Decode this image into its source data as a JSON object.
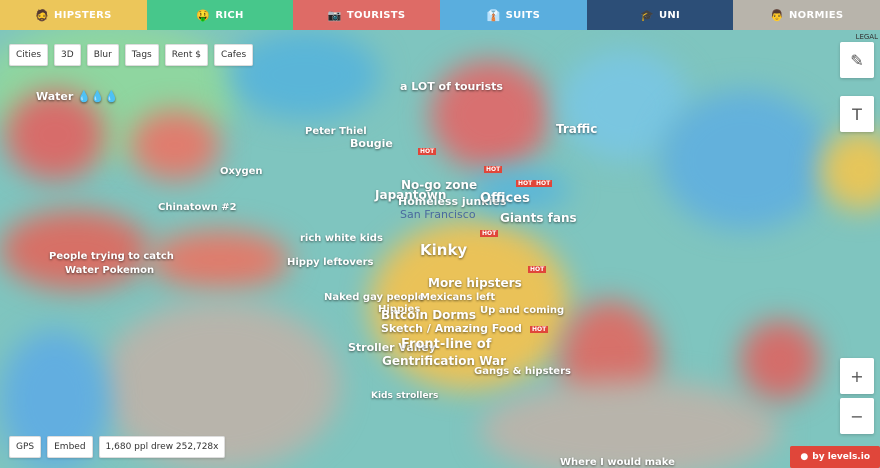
{
  "tabs": [
    {
      "label": "Hipsters",
      "color": "#ecc65a",
      "icon": "🧔"
    },
    {
      "label": "Rich",
      "color": "#47c78b",
      "icon": "🤑"
    },
    {
      "label": "Tourists",
      "color": "#de6b66",
      "icon": "📷"
    },
    {
      "label": "Suits",
      "color": "#5aaede",
      "icon": "👔"
    },
    {
      "label": "Uni",
      "color": "#2c4e77",
      "icon": "🎓"
    },
    {
      "label": "Normies",
      "color": "#b8b4ab",
      "icon": "👨"
    }
  ],
  "toolbar": [
    "Cities",
    "3D",
    "Blur",
    "Tags",
    "Rent $",
    "Cafes"
  ],
  "legal": "LEGAL",
  "side": {
    "draw_icon": "✎",
    "text_icon": "T",
    "zoom_in": "+",
    "zoom_out": "−"
  },
  "bottom": [
    "GPS",
    "Embed",
    "1,680 ppl drew 252,728x"
  ],
  "levels": "by levels.io",
  "map_city": "San Francisco",
  "hot_tag": "HOT",
  "labels": [
    "Water 💧💧💧",
    "a LOT of tourists",
    "Peter Thiel",
    "Bougie",
    "Traffic",
    "Oxygen",
    "No-go zone",
    "Japantown",
    "Homeless junkies",
    "Offices",
    "Chinatown #2",
    "Giants fans",
    "rich white kids",
    "Kinky",
    "People trying to catch",
    "Water Pokemon",
    "Hippy leftovers",
    "More hipsters",
    "Naked gay people",
    "Mexicans left",
    "Hippies",
    "Bitcoin Dorms",
    "Up and coming",
    "Sketch / Amazing Food",
    "Stroller Valley",
    "Front-line of",
    "Gentrification War",
    "Gangs & hipsters",
    "Kids strollers",
    "Where I would make"
  ]
}
